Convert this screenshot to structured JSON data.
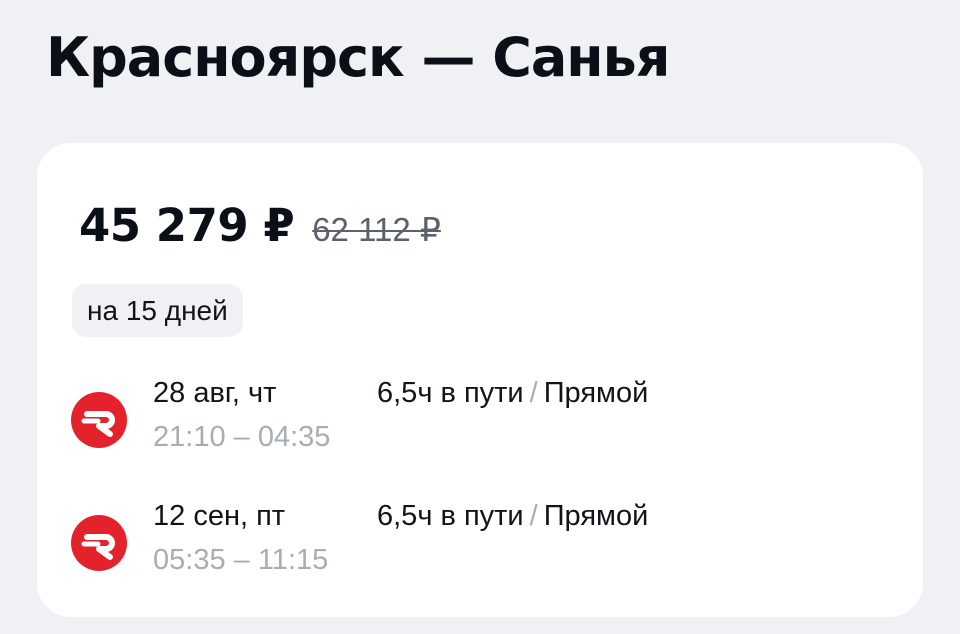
{
  "route": {
    "title": "Красноярск — Санья"
  },
  "offer": {
    "price": "45 279 ₽",
    "old_price": "62 112 ₽",
    "duration_badge": "на 15 дней"
  },
  "flights": [
    {
      "airline_logo": "red-circle-r-logo",
      "date": "28 авг, чт",
      "times": "21:10 – 04:35",
      "travel_time": "6,5ч в пути",
      "separator": "/",
      "stops": "Прямой"
    },
    {
      "airline_logo": "red-circle-r-logo",
      "date": "12 сен, пт",
      "times": "05:35 – 11:15",
      "travel_time": "6,5ч в пути",
      "separator": "/",
      "stops": "Прямой"
    }
  ],
  "colors": {
    "background": "#eff1f5",
    "card": "#ffffff",
    "airline_logo": "#e4222b",
    "muted_text": "#a7adb6"
  }
}
